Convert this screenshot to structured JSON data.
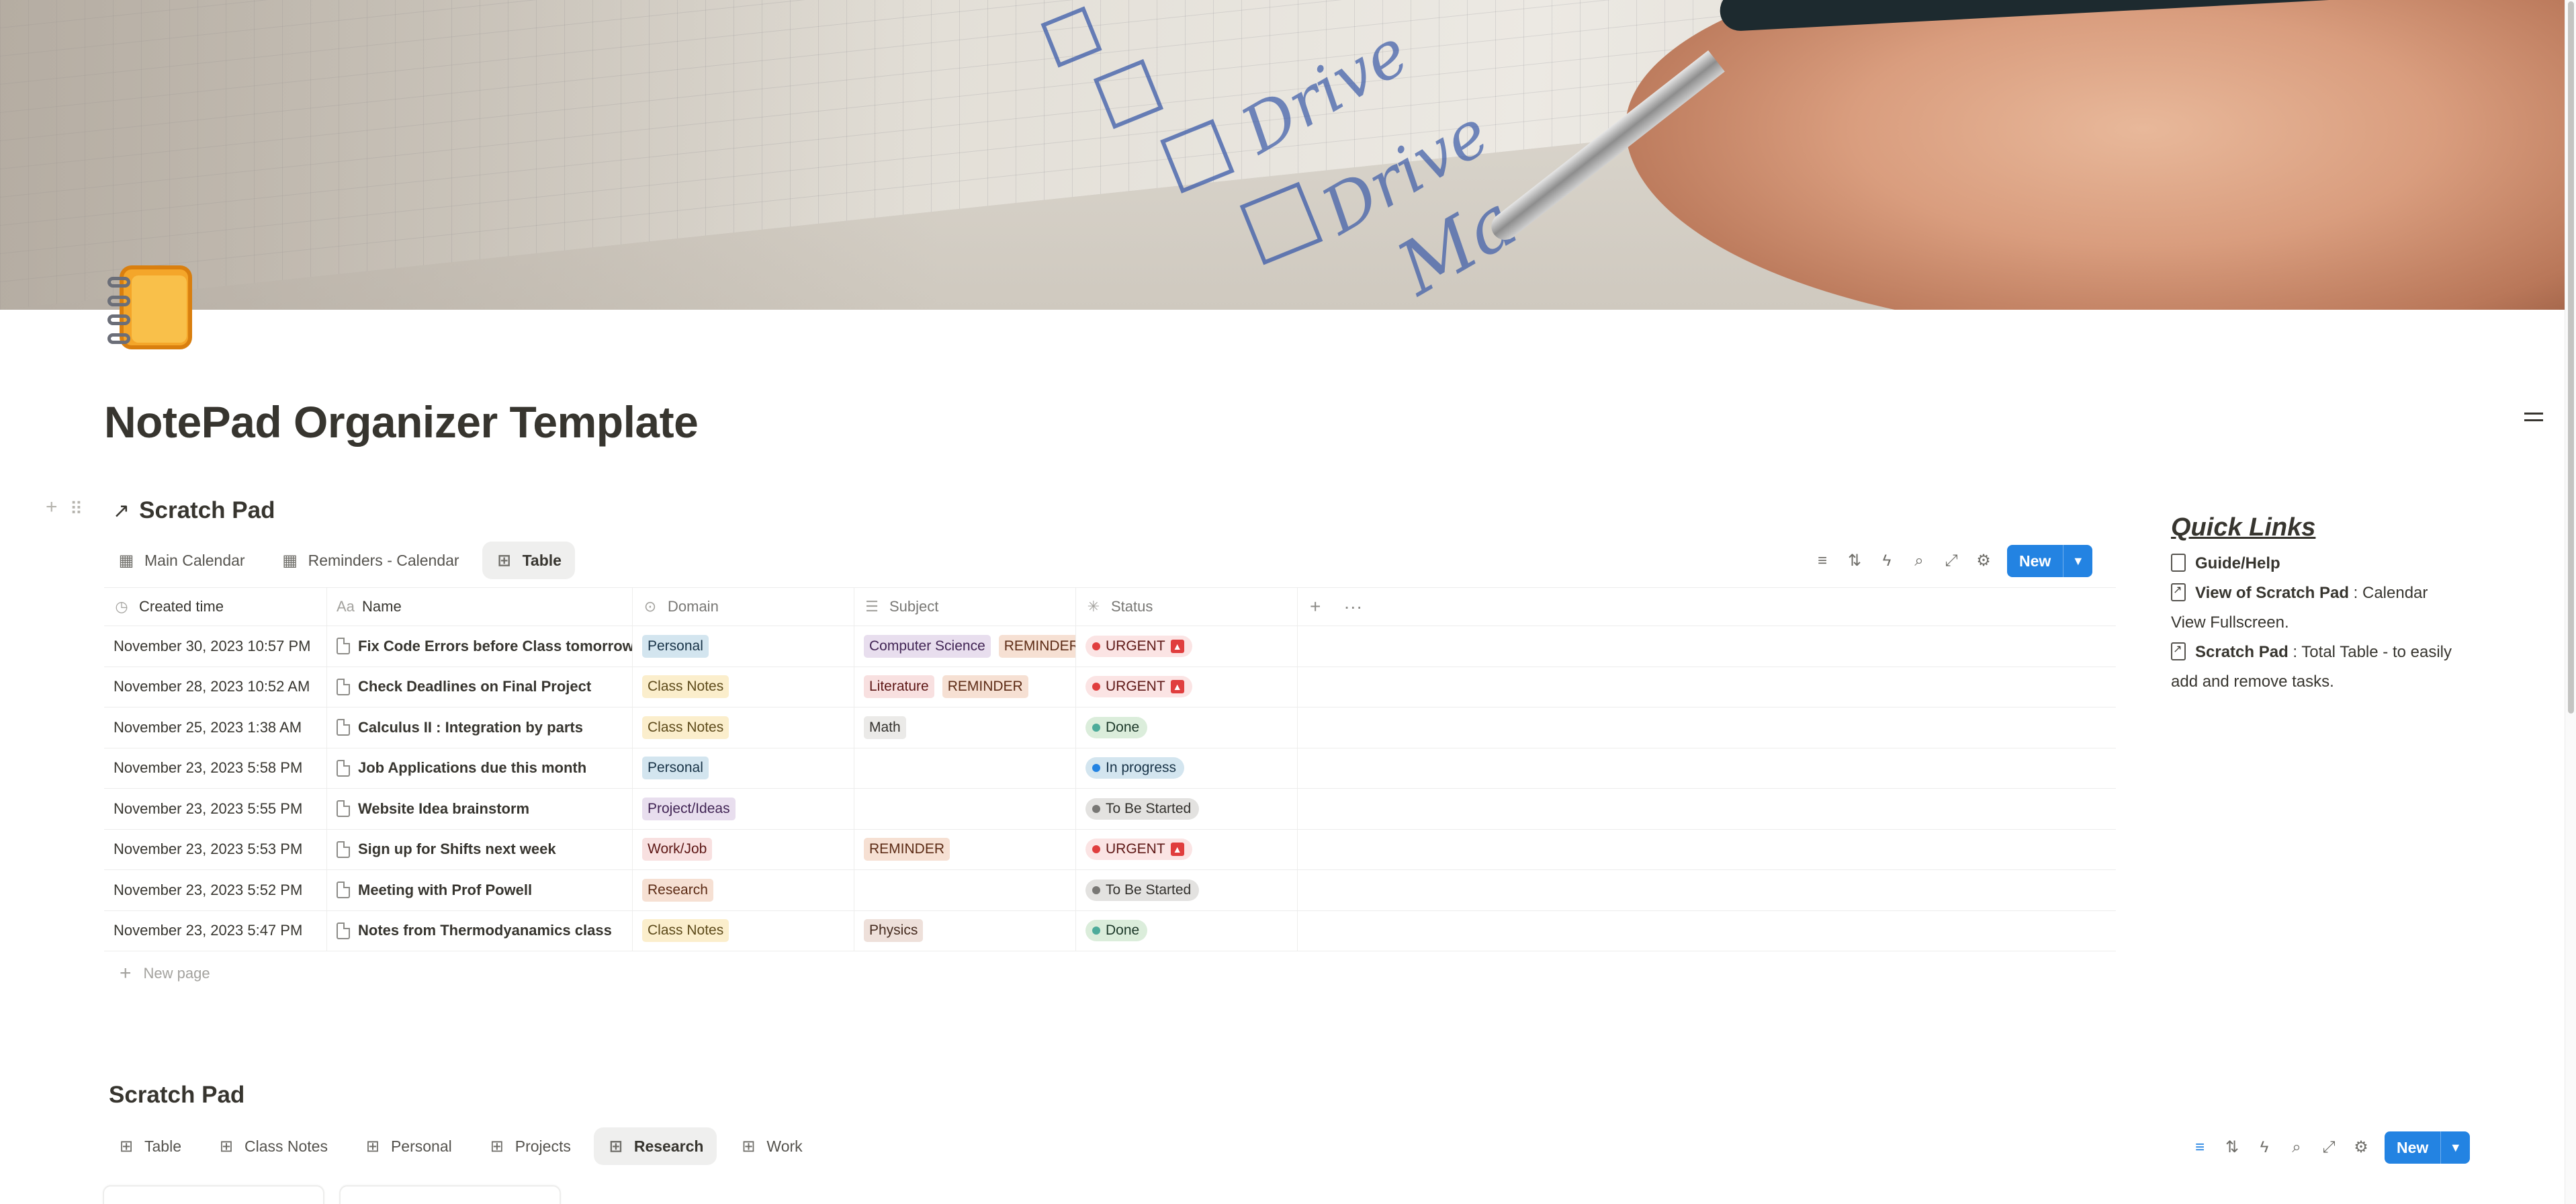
{
  "page": {
    "title": "NotePad Organizer Template"
  },
  "scratch_pad_1": {
    "title": "Scratch Pad",
    "tabs": [
      {
        "label": "Main Calendar",
        "icon": "calendar-icon",
        "active": false
      },
      {
        "label": "Reminders - Calendar",
        "icon": "calendar-icon",
        "active": false
      },
      {
        "label": "Table",
        "icon": "table-icon",
        "active": true
      }
    ],
    "new_label": "New",
    "columns": [
      {
        "label": "Created time",
        "icon": "clock-icon"
      },
      {
        "label": "Name",
        "icon": "text-icon"
      },
      {
        "label": "Domain",
        "icon": "select-icon"
      },
      {
        "label": "Subject",
        "icon": "list-icon"
      },
      {
        "label": "Status",
        "icon": "status-icon"
      }
    ],
    "rows": [
      {
        "created": "November 30, 2023 10:57 PM",
        "name": "Fix Code Errors before Class tomorrow",
        "domain": "Personal",
        "subject": [
          "Computer Science",
          "REMINDER"
        ],
        "status": "URGENT"
      },
      {
        "created": "November 28, 2023 10:52 AM",
        "name": "Check Deadlines on Final Project",
        "domain": "Class Notes",
        "subject": [
          "Literature",
          "REMINDER"
        ],
        "status": "URGENT"
      },
      {
        "created": "November 25, 2023 1:38 AM",
        "name": "Calculus II : Integration by parts",
        "domain": "Class Notes",
        "subject": [
          "Math"
        ],
        "status": "Done"
      },
      {
        "created": "November 23, 2023 5:58 PM",
        "name": "Job Applications due this month",
        "domain": "Personal",
        "subject": [],
        "status": "In progress"
      },
      {
        "created": "November 23, 2023 5:55 PM",
        "name": "Website Idea brainstorm",
        "domain": "Project/Ideas",
        "subject": [],
        "status": "To Be Started"
      },
      {
        "created": "November 23, 2023 5:53 PM",
        "name": "Sign up for Shifts next week",
        "domain": "Work/Job",
        "subject": [
          "REMINDER"
        ],
        "status": "URGENT"
      },
      {
        "created": "November 23, 2023 5:52 PM",
        "name": "Meeting with Prof Powell",
        "domain": "Research",
        "subject": [],
        "status": "To Be Started"
      },
      {
        "created": "November 23, 2023 5:47 PM",
        "name": "Notes from Thermodyanamics class",
        "domain": "Class Notes",
        "subject": [
          "Physics"
        ],
        "status": "Done"
      }
    ],
    "new_page_label": "New page"
  },
  "tag_colors": {
    "Personal": {
      "bg": "#d3e5ef",
      "fg": "#183347"
    },
    "Class Notes": {
      "bg": "#fbeecc",
      "fg": "#5d4a1a"
    },
    "Project/Ideas": {
      "bg": "#e8deee",
      "fg": "#412454"
    },
    "Work/Job": {
      "bg": "#f8e0e0",
      "fg": "#5d1715"
    },
    "Research": {
      "bg": "#f6e0d3",
      "fg": "#5c2b15"
    },
    "Computer Science": {
      "bg": "#e8deee",
      "fg": "#412454"
    },
    "REMINDER": {
      "bg": "#f6e0d3",
      "fg": "#5c2b15"
    },
    "Literature": {
      "bg": "#f8e0e0",
      "fg": "#5d1715"
    },
    "Math": {
      "bg": "#ebeae8",
      "fg": "#32302c"
    },
    "Physics": {
      "bg": "#eee0da",
      "fg": "#442a1e"
    }
  },
  "status_colors": {
    "URGENT": {
      "bg": "#fbe4e4",
      "fg": "#5d1715",
      "dot": "#e03e3e"
    },
    "Done": {
      "bg": "#dbeddb",
      "fg": "#1c3829",
      "dot": "#4dab9a"
    },
    "In progress": {
      "bg": "#d3e5ef",
      "fg": "#183347",
      "dot": "#2383e2"
    },
    "To Be Started": {
      "bg": "#e3e2e0",
      "fg": "#32302c",
      "dot": "#787774"
    }
  },
  "quick_links": {
    "title": "Quick Links",
    "guide": "Guide/Help",
    "view_label": "View of Scratch Pad",
    "view_text": " : Calendar View Fullscreen.",
    "pad_label": "Scratch Pad",
    "pad_text": " : Total Table - to easily add and remove tasks."
  },
  "scratch_pad_2": {
    "title": "Scratch Pad",
    "tabs": [
      {
        "label": "Table",
        "icon": "table-icon",
        "active": false
      },
      {
        "label": "Class Notes",
        "icon": "gallery-icon",
        "active": false
      },
      {
        "label": "Personal",
        "icon": "gallery-icon",
        "active": false
      },
      {
        "label": "Projects",
        "icon": "gallery-icon",
        "active": false
      },
      {
        "label": "Research",
        "icon": "gallery-icon",
        "active": true
      },
      {
        "label": "Work",
        "icon": "gallery-icon",
        "active": false
      }
    ],
    "new_label": "New"
  }
}
